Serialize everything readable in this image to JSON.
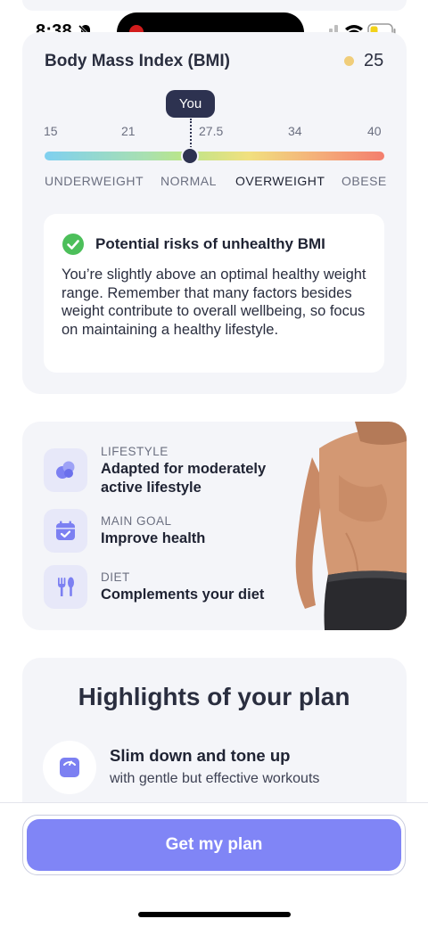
{
  "status_bar": {
    "time": "8:38"
  },
  "bmi": {
    "title": "Body Mass Index (BMI)",
    "value": "25",
    "you_label": "You",
    "ticks": [
      "15",
      "21",
      "27.5",
      "34",
      "40"
    ],
    "categories": [
      "UNDERWEIGHT",
      "NORMAL",
      "OVERWEIGHT",
      "OBESE"
    ],
    "active_category": "OVERWEIGHT",
    "risk_title": "Potential risks of unhealthy BMI",
    "risk_text": "You’re slightly above an optimal healthy weight range. Remember that many factors besides weight contribute to overall wellbeing, so focus on maintaining a healthy lifestyle."
  },
  "plan": {
    "features": [
      {
        "label": "LIFESTYLE",
        "value": "Adapted for moderately active lifestyle",
        "icon": "lifestyle-icon"
      },
      {
        "label": "MAIN GOAL",
        "value": "Improve health",
        "icon": "calendar-check-icon"
      },
      {
        "label": "DIET",
        "value": "Complements your diet",
        "icon": "cutlery-icon"
      }
    ]
  },
  "highlights": {
    "title": "Highlights of your plan",
    "items": [
      {
        "title": "Slim down and tone up",
        "subtitle": "with gentle but effective workouts",
        "icon": "scale-icon"
      }
    ]
  },
  "cta": {
    "label": "Get my plan"
  },
  "colors": {
    "accent": "#8085f6",
    "dark": "#2d3250",
    "card_bg": "#f4f5f9",
    "check": "#4cbf5a"
  }
}
